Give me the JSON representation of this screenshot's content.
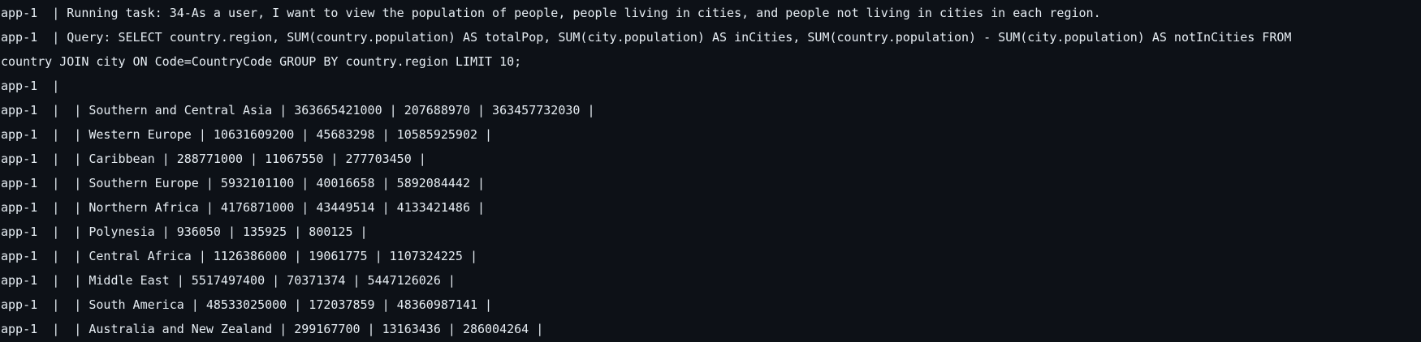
{
  "log": {
    "lines": [
      "app-1  | Running task: 34-As a user, I want to view the population of people, people living in cities, and people not living in cities in each region.",
      "app-1  | Query: SELECT country.region, SUM(country.population) AS totalPop, SUM(city.population) AS inCities, SUM(country.population) - SUM(city.population) AS notInCities FROM",
      "country JOIN city ON Code=CountryCode GROUP BY country.region LIMIT 10;",
      "app-1  |",
      "app-1  |  | Southern and Central Asia | 363665421000 | 207688970 | 363457732030 |",
      "app-1  |  | Western Europe | 10631609200 | 45683298 | 10585925902 |",
      "app-1  |  | Caribbean | 288771000 | 11067550 | 277703450 |",
      "app-1  |  | Southern Europe | 5932101100 | 40016658 | 5892084442 |",
      "app-1  |  | Northern Africa | 4176871000 | 43449514 | 4133421486 |",
      "app-1  |  | Polynesia | 936050 | 135925 | 800125 |",
      "app-1  |  | Central Africa | 1126386000 | 19061775 | 1107324225 |",
      "app-1  |  | Middle East | 5517497400 | 70371374 | 5447126026 |",
      "app-1  |  | South America | 48533025000 | 172037859 | 48360987141 |",
      "app-1  |  | Australia and New Zealand | 299167700 | 13163436 | 286004264 |"
    ]
  }
}
